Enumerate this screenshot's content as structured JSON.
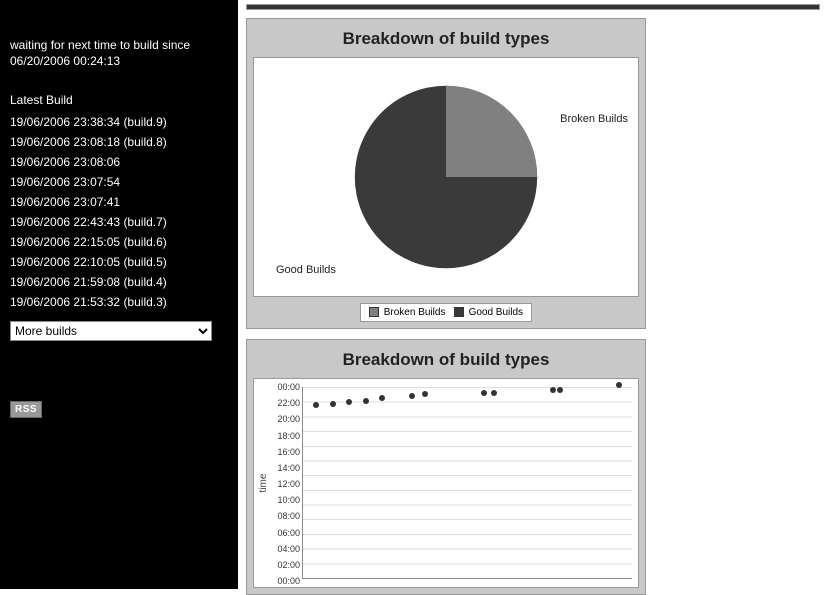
{
  "sidebar": {
    "status_line1": "waiting for next time to build since",
    "status_line2": "06/20/2006 00:24:13",
    "latest_build_header": "Latest Build",
    "builds": [
      "19/06/2006 23:38:34 (build.9)",
      "19/06/2006 23:08:18 (build.8)",
      "19/06/2006 23:08:06",
      "19/06/2006 23:07:54",
      "19/06/2006 23:07:41",
      "19/06/2006 22:43:43 (build.7)",
      "19/06/2006 22:15:05 (build.6)",
      "19/06/2006 22:10:05 (build.5)",
      "19/06/2006 21:59:08 (build.4)",
      "19/06/2006 21:53:32 (build.3)"
    ],
    "more_builds_label": "More builds",
    "rss_label": "RSS"
  },
  "pie_chart_title": "Breakdown of build types",
  "pie_labels": {
    "broken": "Broken Builds",
    "good": "Good Builds"
  },
  "legend": {
    "broken": "Broken Builds",
    "good": "Good Builds"
  },
  "scatter_chart_title": "Breakdown of build types",
  "scatter_ylabel": "time",
  "colors": {
    "good": "#3a3a3a",
    "broken": "#808080",
    "panel": "#c8c8c8"
  },
  "chart_data": [
    {
      "type": "pie",
      "title": "Breakdown of build types",
      "series": [
        {
          "name": "Broken Builds",
          "value": 25,
          "color": "#808080"
        },
        {
          "name": "Good Builds",
          "value": 75,
          "color": "#3a3a3a"
        }
      ],
      "legend_position": "bottom"
    },
    {
      "type": "scatter",
      "title": "Breakdown of build types",
      "xlabel": "",
      "ylabel": "time",
      "ylim": [
        0,
        26
      ],
      "y_ticks": [
        "00:00",
        "22:00",
        "20:00",
        "18:00",
        "16:00",
        "14:00",
        "12:00",
        "10:00",
        "08:00",
        "06:00",
        "04:00",
        "02:00",
        "00:00"
      ],
      "points": [
        {
          "x": 0.04,
          "y_hour": 21.8
        },
        {
          "x": 0.09,
          "y_hour": 21.9
        },
        {
          "x": 0.14,
          "y_hour": 22.1
        },
        {
          "x": 0.19,
          "y_hour": 22.2
        },
        {
          "x": 0.24,
          "y_hour": 22.6
        },
        {
          "x": 0.33,
          "y_hour": 22.9
        },
        {
          "x": 0.37,
          "y_hour": 23.1
        },
        {
          "x": 0.55,
          "y_hour": 23.3
        },
        {
          "x": 0.58,
          "y_hour": 23.3
        },
        {
          "x": 0.76,
          "y_hour": 23.6
        },
        {
          "x": 0.78,
          "y_hour": 23.6
        },
        {
          "x": 0.96,
          "y_hour": 24.2
        }
      ]
    }
  ]
}
